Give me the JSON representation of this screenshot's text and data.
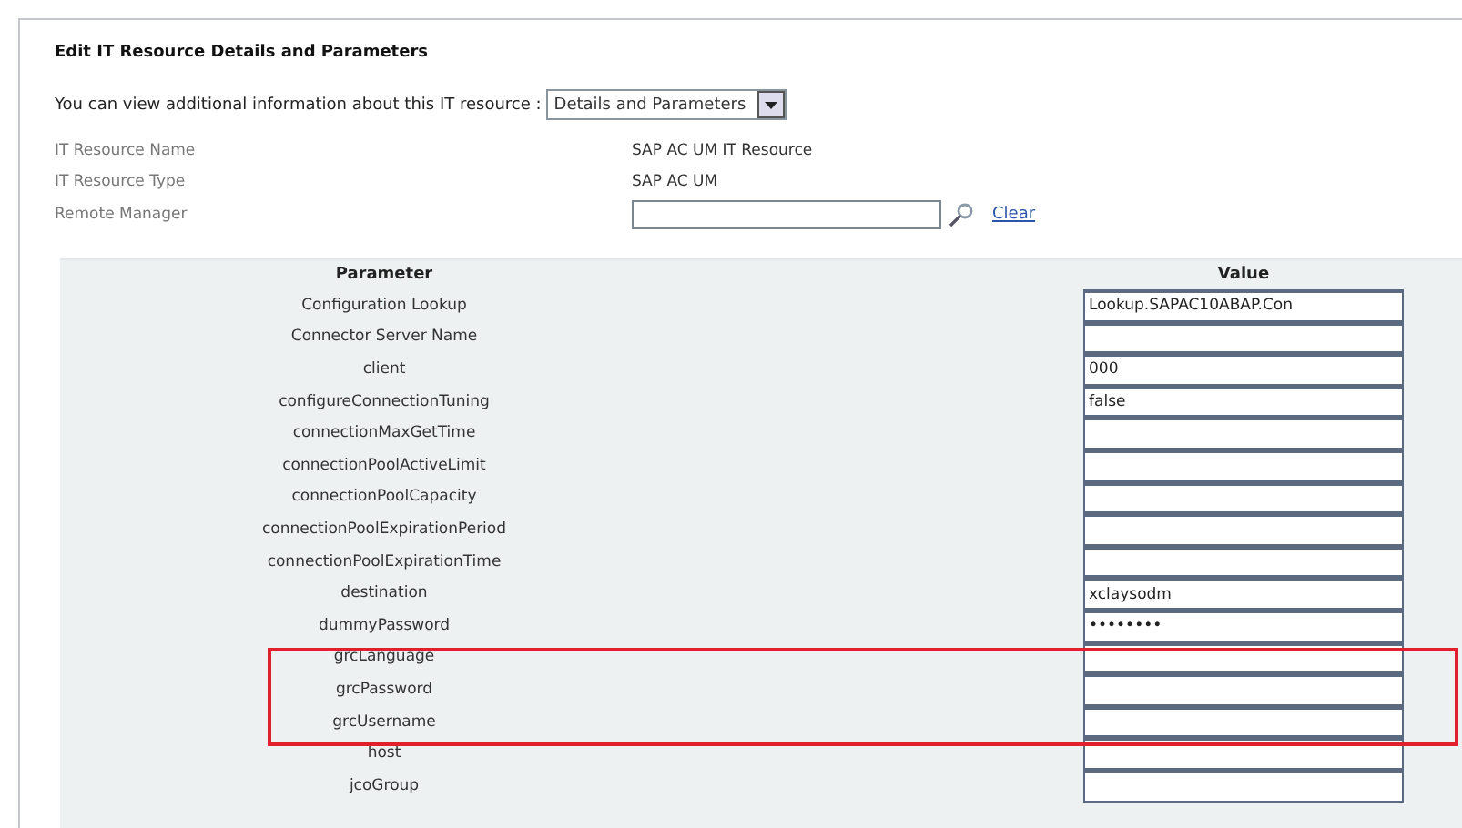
{
  "title": "Edit IT Resource Details and Parameters",
  "info": {
    "label": "You can view additional information about this IT resource :",
    "dropdown": "Details and Parameters"
  },
  "properties": [
    {
      "label": "IT Resource Name",
      "kind": "text",
      "value": "SAP AC UM IT Resource"
    },
    {
      "label": "IT Resource Type",
      "kind": "text",
      "value": "SAP AC UM"
    },
    {
      "label": "Remote Manager",
      "kind": "lookup",
      "link": "Clear"
    }
  ],
  "table": {
    "columns": [
      "Parameter",
      "Value"
    ],
    "rows": [
      {
        "name": "Configuration Lookup",
        "value": "Lookup.SAPAC10ABAP.Con",
        "highlighted": false
      },
      {
        "name": "Connector Server Name",
        "highlighted": false
      },
      {
        "name": "client",
        "value": "000",
        "highlighted": false
      },
      {
        "name": "configureConnectionTuning",
        "value": "false",
        "highlighted": false
      },
      {
        "name": "connectionMaxGetTime",
        "highlighted": false
      },
      {
        "name": "connectionPoolActiveLimit",
        "highlighted": false
      },
      {
        "name": "connectionPoolCapacity",
        "highlighted": false
      },
      {
        "name": "connectionPoolExpirationPeriod",
        "highlighted": false
      },
      {
        "name": "connectionPoolExpirationTime",
        "highlighted": false
      },
      {
        "name": "destination",
        "value": "xclaysodm",
        "highlighted": false
      },
      {
        "name": "dummyPassword",
        "value": "••••••••",
        "highlighted": false
      },
      {
        "name": "grcLanguage",
        "highlighted": true
      },
      {
        "name": "grcPassword",
        "highlighted": true
      },
      {
        "name": "grcUsername",
        "highlighted": true
      },
      {
        "name": "host",
        "highlighted": false
      },
      {
        "name": "jcoGroup",
        "highlighted": false
      }
    ]
  }
}
